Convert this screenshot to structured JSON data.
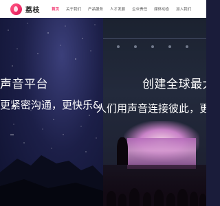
{
  "header": {
    "brand": "荔枝",
    "nav": [
      {
        "label": "首页",
        "active": true
      },
      {
        "label": "关于我们",
        "active": false
      },
      {
        "label": "产品服务",
        "active": false
      },
      {
        "label": "人才发展",
        "active": false
      },
      {
        "label": "企业责任",
        "active": false
      },
      {
        "label": "媒体动态",
        "active": false
      },
      {
        "label": "加入我们",
        "active": false
      }
    ]
  },
  "hero": {
    "left": {
      "headline": "声音平台",
      "subline": "更紧密沟通，更快乐&"
    },
    "right": {
      "headline": "创建全球最大",
      "subline": "人们用声音连接彼此，更"
    }
  },
  "colors": {
    "accent": "#f0306b",
    "nav_bg": "#ffffff"
  }
}
